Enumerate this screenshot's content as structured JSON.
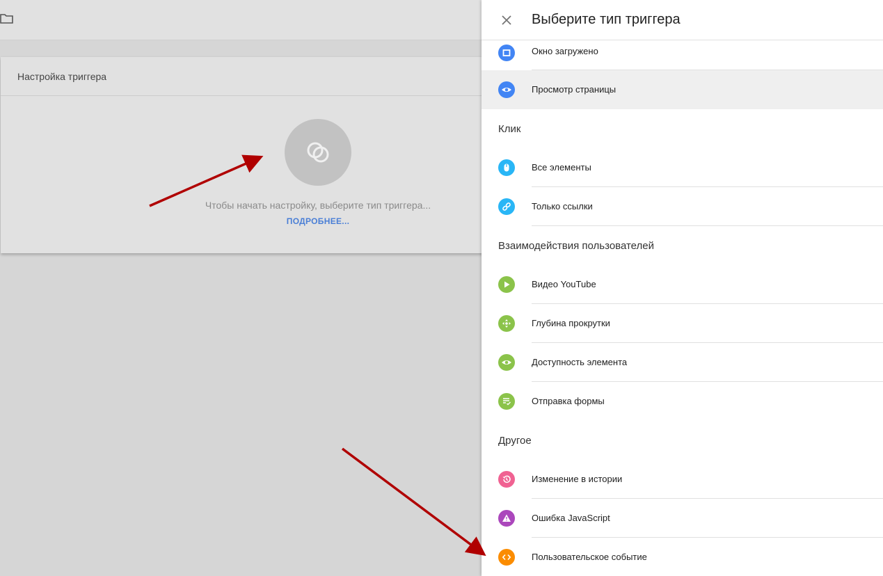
{
  "card": {
    "title": "Настройка триггера",
    "hint": "Чтобы начать настройку, выберите тип триггера...",
    "more_link": "ПОДРОБНЕЕ..."
  },
  "panel": {
    "title": "Выберите тип триггера",
    "page_view": [
      {
        "label": "Окно загружено",
        "icon": "window-icon",
        "color": "#4285f4"
      },
      {
        "label": "Просмотр страницы",
        "icon": "eye-icon",
        "color": "#4285f4"
      }
    ],
    "sections": {
      "click": "Клик",
      "user": "Взаимодействия пользователей",
      "other": "Другое"
    },
    "click": [
      {
        "label": "Все элементы",
        "icon": "mouse-icon",
        "color": "#29b6f6"
      },
      {
        "label": "Только ссылки",
        "icon": "link-icon",
        "color": "#29b6f6"
      }
    ],
    "user": [
      {
        "label": "Видео YouTube",
        "icon": "play-icon",
        "color": "#8bc34a"
      },
      {
        "label": "Глубина прокрутки",
        "icon": "scroll-icon",
        "color": "#8bc34a"
      },
      {
        "label": "Доступность элемента",
        "icon": "eye-icon",
        "color": "#8bc34a"
      },
      {
        "label": "Отправка формы",
        "icon": "form-icon",
        "color": "#8bc34a"
      }
    ],
    "other": [
      {
        "label": "Изменение в истории",
        "icon": "history-icon",
        "color": "#f06292"
      },
      {
        "label": "Ошибка JavaScript",
        "icon": "warning-icon",
        "color": "#ab47bc"
      },
      {
        "label": "Пользовательское событие",
        "icon": "code-icon",
        "color": "#fb8c00"
      }
    ]
  },
  "colors": {
    "arrow": "#b00000",
    "link": "#4a7fd6"
  }
}
